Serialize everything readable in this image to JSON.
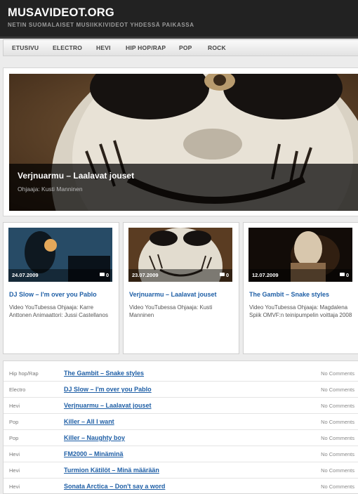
{
  "site": {
    "title": "MUSAVIDEOT.ORG",
    "tagline": "NETIN SUOMALAISET MUSIIKKIVIDEOT YHDESSÄ PAIKASSA"
  },
  "nav": [
    "ETUSIVU",
    "ELECTRO",
    "HEVI",
    "HIP HOP/RAP",
    "POP",
    "ROCK"
  ],
  "featured": {
    "title": "Verjnuarmu – Laalavat jouset",
    "subtitle": "Ohjaaja: Kusti Manninen"
  },
  "cards": [
    {
      "date": "24.07.2009",
      "comments": "0",
      "title": "DJ Slow – I'm over you Pablo",
      "desc": "Video YouTubessa Ohjaaja: Karre Anttonen Animaattori: Jussi Castellanos"
    },
    {
      "date": "23.07.2009",
      "comments": "0",
      "title": "Verjnuarmu – Laalavat jouset",
      "desc": "Video YouTubessa Ohjaaja: Kusti Manninen"
    },
    {
      "date": "12.07.2009",
      "comments": "0",
      "title": "The Gambit – Snake styles",
      "desc": "Video YouTubessa Ohjaaja: Magdalena Spiik OMVF:n teinipumpelin voittaja 2008"
    }
  ],
  "list": [
    {
      "category": "Hip hop/Rap",
      "title": "The Gambit – Snake styles",
      "comments": "No Comments"
    },
    {
      "category": "Electro",
      "title": "DJ Slow – I'm over you Pablo",
      "comments": "No Comments"
    },
    {
      "category": "Hevi",
      "title": "Verjnuarmu – Laalavat jouset",
      "comments": "No Comments"
    },
    {
      "category": "Pop",
      "title": "Killer – All I want",
      "comments": "No Comments"
    },
    {
      "category": "Pop",
      "title": "Killer – Naughty boy",
      "comments": "No Comments"
    },
    {
      "category": "Hevi",
      "title": "FM2000 – Minäminä",
      "comments": "No Comments"
    },
    {
      "category": "Hevi",
      "title": "Turmion Kätilöt – Minä määrään",
      "comments": "No Comments"
    },
    {
      "category": "Hevi",
      "title": "Sonata Arctica – Don't say a word",
      "comments": "No Comments"
    }
  ]
}
